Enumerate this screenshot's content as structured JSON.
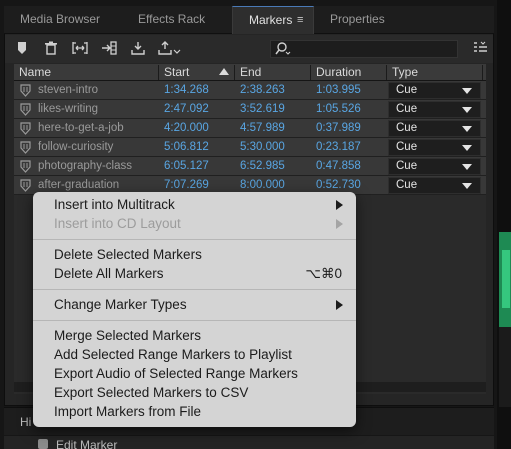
{
  "tabs": [
    {
      "label": "Media Browser",
      "active": false
    },
    {
      "label": "Effects Rack",
      "active": false
    },
    {
      "label": "Markers",
      "active": true
    },
    {
      "label": "Properties",
      "active": false
    }
  ],
  "tab_menu_icon": "hamburger-icon",
  "toolbar": {
    "icons": [
      "add-marker-icon",
      "trash-icon",
      "merge-markers-icon",
      "insert-into-multitrack-icon",
      "export-icon",
      "batch-process-icon",
      "column-options-icon"
    ],
    "search_placeholder": "",
    "search_icon": "magnifier-dropdown-icon"
  },
  "table": {
    "columns": [
      "Name",
      "Start",
      "End",
      "Duration",
      "Type"
    ],
    "sort_column": "Start",
    "rows": [
      {
        "name": "steven-intro",
        "start": "1:34.268",
        "end": "2:38.263",
        "duration": "1:03.995",
        "type": "Cue"
      },
      {
        "name": "likes-writing",
        "start": "2:47.092",
        "end": "3:52.619",
        "duration": "1:05.526",
        "type": "Cue"
      },
      {
        "name": "here-to-get-a-job",
        "start": "4:20.000",
        "end": "4:57.989",
        "duration": "0:37.989",
        "type": "Cue"
      },
      {
        "name": "follow-curiosity",
        "start": "5:06.812",
        "end": "5:30.000",
        "duration": "0:23.187",
        "type": "Cue"
      },
      {
        "name": "photography-class",
        "start": "6:05.127",
        "end": "6:52.985",
        "duration": "0:47.858",
        "type": "Cue"
      },
      {
        "name": "after-graduation",
        "start": "7:07.269",
        "end": "8:00.000",
        "duration": "0:52.730",
        "type": "Cue"
      }
    ]
  },
  "context_menu": {
    "items": [
      {
        "label": "Insert into Multitrack",
        "submenu": true,
        "disabled": false
      },
      {
        "label": "Insert into CD Layout",
        "submenu": true,
        "disabled": true
      },
      {
        "label": "Delete Selected Markers",
        "disabled": false
      },
      {
        "label": "Delete All Markers",
        "shortcut": "⌥⌘0",
        "disabled": false
      },
      {
        "label": "Change Marker Types",
        "submenu": true,
        "disabled": false
      },
      {
        "label": "Merge Selected Markers",
        "disabled": false
      },
      {
        "label": "Add Selected Range Markers to Playlist",
        "disabled": false
      },
      {
        "label": "Export Audio of Selected Range Markers",
        "disabled": false
      },
      {
        "label": "Export Selected Markers to CSV",
        "disabled": false
      },
      {
        "label": "Import Markers from File",
        "disabled": false
      }
    ]
  },
  "history": {
    "tab_label": "Hi",
    "item_label": "Edit Marker"
  },
  "colors": {
    "time_text": "#59a6e3",
    "accent_tab": "#4a7ab8",
    "menu_bg": "#d4d4d4",
    "waveform": "#35c77e"
  }
}
